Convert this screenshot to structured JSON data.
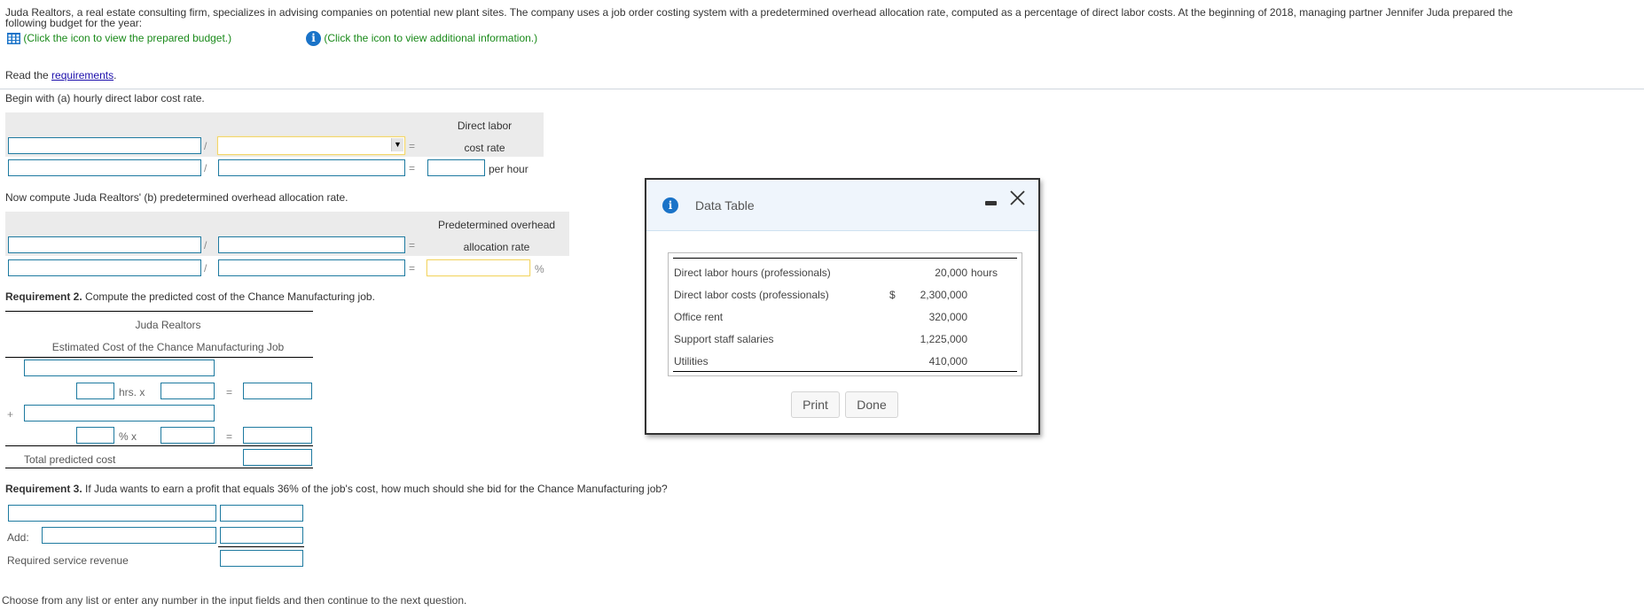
{
  "intro": {
    "line1": "Juda Realtors, a real estate consulting firm, specializes in advising companies on potential new plant sites. The company uses a job order costing system with a predetermined overhead allocation rate, computed as a percentage of direct labor costs. At the beginning of 2018, managing partner Jennifer Juda prepared the",
    "line2": "following budget for the year:",
    "budget_link": "(Click the icon to view the prepared budget.)",
    "info_link": "(Click the icon to view additional information.)",
    "budget_icon": "grid-table-icon",
    "info_icon": "info-icon"
  },
  "read_req": {
    "prefix": "Read the ",
    "link": "requirements",
    "suffix": "."
  },
  "part_a": {
    "instruction": "Begin with (a) hourly direct labor cost rate.",
    "header_line1": "Direct labor",
    "header_line2": "cost rate",
    "divide": "/",
    "equals": "=",
    "unit": "per hour",
    "dropdown_value": ""
  },
  "part_b": {
    "instruction": "Now compute Juda Realtors' (b) predetermined overhead allocation rate.",
    "header_line1": "Predetermined overhead",
    "header_line2": "allocation rate",
    "divide": "/",
    "equals": "=",
    "unit": "%"
  },
  "req2": {
    "bold": "Requirement 2.",
    "text": " Compute the predicted cost of the Chance Manufacturing job.",
    "company": "Juda Realtors",
    "title": "Estimated Cost of the Chance Manufacturing Job",
    "hrs_label": "hrs. x",
    "pct_label": "% x",
    "plus": "+",
    "equals": "=",
    "total_label": "Total predicted cost"
  },
  "req3": {
    "bold": "Requirement 3.",
    "text": " If Juda wants to earn a profit that equals 36% of the job's cost, how much should she bid for the Chance Manufacturing job?",
    "add_label": "Add:",
    "revenue_label": "Required service revenue"
  },
  "footer": {
    "hint": "Choose from any list or enter any number in the input fields and then continue to the next question."
  },
  "dialog": {
    "title": "Data Table",
    "minimize": "–",
    "close": "✕",
    "rows": [
      {
        "label": "Direct labor hours (professionals)",
        "currency": "",
        "value": "20,000",
        "unit": "hours"
      },
      {
        "label": "Direct labor costs (professionals)",
        "currency": "$",
        "value": "2,300,000",
        "unit": ""
      },
      {
        "label": "Office rent",
        "currency": "",
        "value": "320,000",
        "unit": ""
      },
      {
        "label": "Support staff salaries",
        "currency": "",
        "value": "1,225,000",
        "unit": ""
      },
      {
        "label": "Utilities",
        "currency": "",
        "value": "410,000",
        "unit": ""
      }
    ],
    "print_label": "Print",
    "done_label": "Done"
  },
  "colors": {
    "input_border": "#1e7aa0",
    "highlight_border": "#f3d66a",
    "link_green": "#1a8a1a",
    "info_blue": "#1a73c8"
  }
}
